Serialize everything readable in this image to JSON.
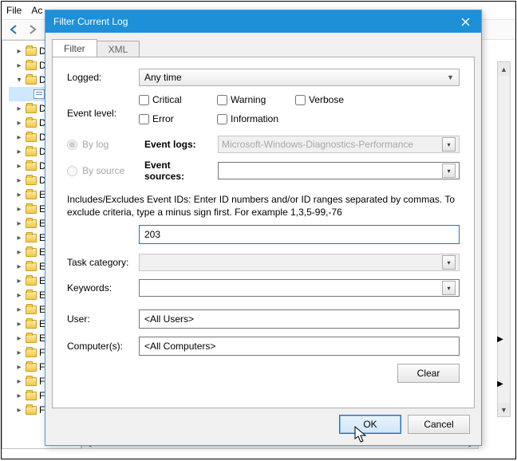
{
  "menu": {
    "file": "File",
    "action_partial": "Ac"
  },
  "tree": {
    "items": [
      {
        "label": "Dia",
        "depth": 1,
        "tw": "▸",
        "ico": "folder"
      },
      {
        "label": "Dia",
        "depth": 1,
        "tw": "▸",
        "ico": "folder"
      },
      {
        "label": "Dia",
        "depth": 1,
        "tw": "▾",
        "ico": "folder"
      },
      {
        "label": "",
        "depth": 2,
        "tw": "",
        "ico": "log",
        "selected": true
      },
      {
        "label": "Disl",
        "depth": 1,
        "tw": "▸",
        "ico": "folder"
      },
      {
        "label": "Disl",
        "depth": 1,
        "tw": "▸",
        "ico": "folder"
      },
      {
        "label": "Disl",
        "depth": 1,
        "tw": "▸",
        "ico": "folder"
      },
      {
        "label": "Dis",
        "depth": 1,
        "tw": "▸",
        "ico": "folder"
      },
      {
        "label": "DN",
        "depth": 1,
        "tw": "▸",
        "ico": "folder"
      },
      {
        "label": "Dri",
        "depth": 1,
        "tw": "▸",
        "ico": "folder"
      },
      {
        "label": "Eap",
        "depth": 1,
        "tw": "▸",
        "ico": "folder"
      },
      {
        "label": "Eap",
        "depth": 1,
        "tw": "▸",
        "ico": "folder"
      },
      {
        "label": "Eap",
        "depth": 1,
        "tw": "▸",
        "ico": "folder"
      },
      {
        "label": "Eap",
        "depth": 1,
        "tw": "▸",
        "ico": "folder"
      },
      {
        "label": "Eap",
        "depth": 1,
        "tw": "▸",
        "ico": "folder"
      },
      {
        "label": "EDI",
        "depth": 1,
        "tw": "▸",
        "ico": "folder"
      },
      {
        "label": "EDI",
        "depth": 1,
        "tw": "▸",
        "ico": "folder"
      },
      {
        "label": "Ene",
        "depth": 1,
        "tw": "▸",
        "ico": "folder"
      },
      {
        "label": "ESE",
        "depth": 1,
        "tw": "▸",
        "ico": "folder"
      },
      {
        "label": "Eve",
        "depth": 1,
        "tw": "▸",
        "ico": "folder"
      },
      {
        "label": "Eve",
        "depth": 1,
        "tw": "▸",
        "ico": "folder"
      },
      {
        "label": "Fau",
        "depth": 1,
        "tw": "▸",
        "ico": "folder"
      },
      {
        "label": "File",
        "depth": 1,
        "tw": "▸",
        "ico": "folder"
      },
      {
        "label": "File",
        "depth": 1,
        "tw": "▸",
        "ico": "folder"
      },
      {
        "label": "FM",
        "depth": 1,
        "tw": "▸",
        "ico": "folder"
      },
      {
        "label": "Fol",
        "depth": 1,
        "tw": "▸",
        "ico": "folder"
      }
    ]
  },
  "dialog": {
    "title": "Filter Current Log",
    "tabs": {
      "filter": "Filter",
      "xml": "XML"
    },
    "logged_label": "Logged:",
    "logged_value": "Any time",
    "level_label": "Event level:",
    "levels": {
      "critical": "Critical",
      "warning": "Warning",
      "verbose": "Verbose",
      "error": "Error",
      "information": "Information"
    },
    "by_log": "By log",
    "by_source": "By source",
    "event_logs_label": "Event logs:",
    "event_logs_value": "Microsoft-Windows-Diagnostics-Performance",
    "event_sources_label": "Event sources:",
    "event_sources_value": "",
    "id_help": "Includes/Excludes Event IDs: Enter ID numbers and/or ID ranges separated by commas. To exclude criteria, type a minus sign first. For example 1,3,5-99,-76",
    "id_value": "203",
    "task_label": "Task category:",
    "task_value": "",
    "keywords_label": "Keywords:",
    "keywords_value": "",
    "user_label": "User:",
    "user_value": "<All Users>",
    "computers_label": "Computer(s):",
    "computers_value": "<All Computers>",
    "clear": "Clear",
    "ok": "OK",
    "cancel": "Cancel"
  }
}
